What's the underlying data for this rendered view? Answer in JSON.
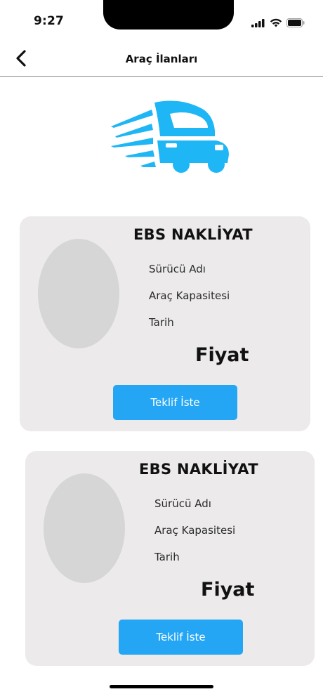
{
  "status_bar": {
    "time": "9:27",
    "icons": [
      "signal-icon",
      "wifi-icon",
      "battery-icon"
    ]
  },
  "header": {
    "back_icon": "chevron-left-icon",
    "title": "Araç İlanları"
  },
  "logo": {
    "icon": "truck-logo-icon",
    "color": "#1fb6f6"
  },
  "cards": [
    {
      "company": "EBS NAKLİYAT",
      "driver_label": "Sürücü Adı",
      "capacity_label": "Araç Kapasitesi",
      "date_label": "Tarih",
      "price_label": "Fiyat",
      "button_label": "Teklif İste"
    },
    {
      "company": "EBS NAKLİYAT",
      "driver_label": "Sürücü Adı",
      "capacity_label": "Araç Kapasitesi",
      "date_label": "Tarih",
      "price_label": "Fiyat",
      "button_label": "Teklif İste"
    }
  ],
  "colors": {
    "card_background": "#eceaea",
    "avatar_placeholder": "#d6d6d6",
    "button": "#24a6f5"
  }
}
